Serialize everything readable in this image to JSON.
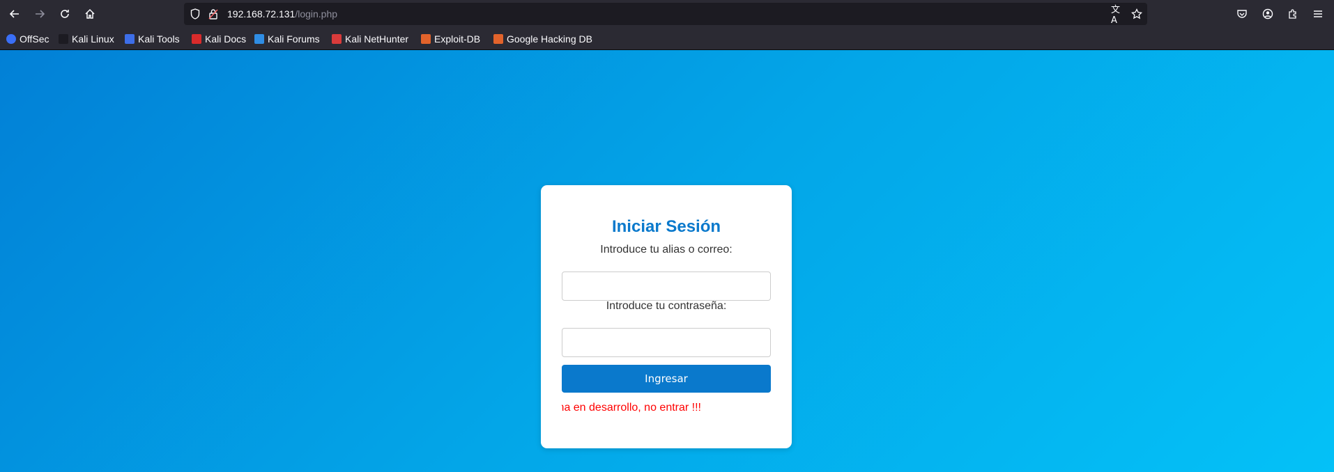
{
  "browser": {
    "url_host": "192.168.72.131",
    "url_path": "/login.php",
    "bookmarks": [
      {
        "label": "OffSec",
        "color": "#3a6ff7"
      },
      {
        "label": "Kali Linux",
        "color": "#1c1b22"
      },
      {
        "label": "Kali Tools",
        "color": "#3d6ee8"
      },
      {
        "label": "Kali Docs",
        "color": "#d92b2b"
      },
      {
        "label": "Kali Forums",
        "color": "#2f8de4"
      },
      {
        "label": "Kali NetHunter",
        "color": "#d93b3b"
      },
      {
        "label": "Exploit-DB",
        "color": "#e2632b"
      },
      {
        "label": "Google Hacking DB",
        "color": "#e2632b"
      }
    ]
  },
  "login": {
    "title": "Iniciar Sesión",
    "user_label": "Introduce tu alias o correo:",
    "user_value": "",
    "password_label": "Introduce tu contraseña:",
    "password_value": "",
    "submit_label": "Ingresar",
    "warning": "Página en desarrollo, no entrar !!!"
  },
  "colors": {
    "accent": "#0a79cc",
    "warning": "#ff0000",
    "background_start": "#0280d6",
    "background_end": "#04c1f7"
  }
}
